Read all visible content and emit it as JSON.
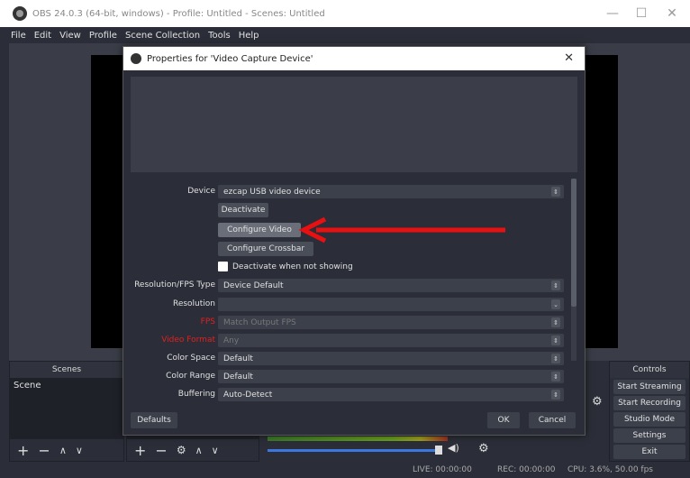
{
  "window": {
    "title": "OBS 24.0.3 (64-bit, windows) - Profile: Untitled - Scenes: Untitled",
    "minimize": "—",
    "maximize": "☐",
    "close": "✕"
  },
  "menu": {
    "items": [
      "File",
      "Edit",
      "View",
      "Profile",
      "Scene Collection",
      "Tools",
      "Help"
    ]
  },
  "dialog": {
    "title": "Properties for 'Video Capture Device'",
    "close": "✕",
    "device_label": "Device",
    "device_value": "ezcap USB video device",
    "deactivate_button": "Deactivate",
    "configure_video_button": "Configure Video",
    "configure_crossbar_button": "Configure Crossbar",
    "deactivate_checkbox_label": "Deactivate when not showing",
    "resolution_fps_type_label": "Resolution/FPS Type",
    "resolution_fps_type_value": "Device Default",
    "resolution_label": "Resolution",
    "resolution_value": "",
    "fps_label": "FPS",
    "fps_value": "Match Output FPS",
    "video_format_label": "Video Format",
    "video_format_value": "Any",
    "color_space_label": "Color Space",
    "color_space_value": "Default",
    "color_range_label": "Color Range",
    "color_range_value": "Default",
    "buffering_label": "Buffering",
    "buffering_value": "Auto-Detect",
    "defaults_button": "Defaults",
    "ok_button": "OK",
    "cancel_button": "Cancel"
  },
  "docks": {
    "scenes_header": "Scenes",
    "scene_item": "Scene",
    "controls_header": "Controls",
    "controls": [
      "Start Streaming",
      "Start Recording",
      "Studio Mode",
      "Settings",
      "Exit"
    ]
  },
  "status": {
    "live": "LIVE: 00:00:00",
    "rec": "REC: 00:00:00",
    "cpu": "CPU: 3.6%, 50.00 fps"
  },
  "colors": {
    "accent_arrow": "#e81010",
    "warning_label": "#e02020",
    "background": "#2b2e38"
  }
}
